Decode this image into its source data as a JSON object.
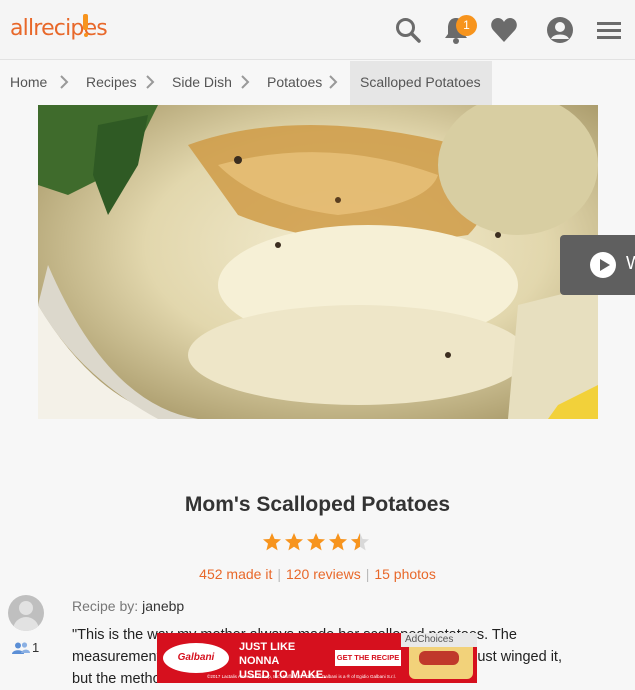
{
  "header": {
    "logo_text": "allrecipes",
    "notification_count": "1",
    "icons": [
      "search-icon",
      "bell-icon",
      "heart-icon",
      "user-icon",
      "menu-icon"
    ],
    "brand_color": "#e8682a",
    "accent_color": "#f7941d"
  },
  "breadcrumb": {
    "items": [
      "Home",
      "Recipes",
      "Side Dish",
      "Potatoes"
    ],
    "current": "Scalloped Potatoes"
  },
  "hero": {
    "video_label": "W"
  },
  "recipe": {
    "title": "Mom's Scalloped Potatoes",
    "rating": 4.5,
    "made_it": "452 made it",
    "reviews": "120 reviews",
    "photos": "15 photos",
    "by_label": "Recipe by:",
    "author": "janebp",
    "followers": "1",
    "description_lines": [
      "\"This is the way my mother always made her scalloped potatoes. The",
      "measurements are my best guess because my mother always just winged it,",
      "but the method is the same."
    ]
  },
  "ad": {
    "brand": "Galbani",
    "headline_1": "JUST LIKE NONNA",
    "headline_2": "USED TO MAKE.",
    "cta": "GET THE RECIPE ▶",
    "fine_print": "©2017 Lactalis American Group, Inc., Buffalo, NY 14220. Galbani is a ® of Egidio Galbani S.r.l.",
    "adchoices": "AdChoices"
  }
}
